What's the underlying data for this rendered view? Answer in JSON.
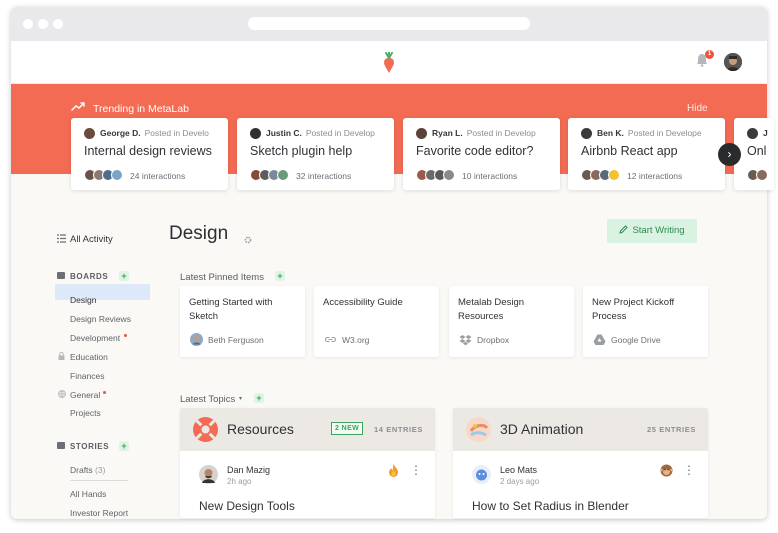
{
  "header": {
    "notification_count": "1"
  },
  "trending": {
    "title": "Trending in MetaLab",
    "hide_label": "Hide",
    "cards": [
      {
        "author": "George D.",
        "posted": "Posted in Develo",
        "title": "Internal design reviews",
        "interactions": "24 interactions"
      },
      {
        "author": "Justin C.",
        "posted": "Posted in Develop",
        "title": "Sketch plugin help",
        "interactions": "32 interactions"
      },
      {
        "author": "Ryan L.",
        "posted": "Posted in Develop",
        "title": "Favorite code editor?",
        "interactions": "10 interactions"
      },
      {
        "author": "Ben K.",
        "posted": "Posted in Develope",
        "title": "Airbnb React app",
        "interactions": "12 interactions"
      },
      {
        "author": "J",
        "posted": "",
        "title": "Onl",
        "interactions": ""
      }
    ],
    "next_glyph": "›"
  },
  "sidebar": {
    "all_activity": "All Activity",
    "boards_heading": "BOARDS",
    "boards": [
      "Design",
      "Design Reviews",
      "Development",
      "Education",
      "Finances",
      "General",
      "Projects"
    ],
    "stories_heading": "STORIES",
    "drafts": "Drafts",
    "drafts_count": "(3)",
    "stories": [
      "All Hands",
      "Investor Report"
    ],
    "plus": "+"
  },
  "main": {
    "title": "Design",
    "start_writing": "Start Writing",
    "pinned_heading": "Latest Pinned Items",
    "pinned": [
      {
        "title": "Getting Started with Sketch",
        "source": "Beth Ferguson"
      },
      {
        "title": "Accessibility Guide",
        "source": "W3.org"
      },
      {
        "title": "Metalab Design Resources",
        "source": "Dropbox"
      },
      {
        "title": "New Project Kickoff Process",
        "source": "Google Drive"
      }
    ],
    "topics_heading": "Latest Topics",
    "topics_caret": "▾",
    "topics": [
      {
        "name": "Resources",
        "badge": "2 NEW",
        "entries": "14 ENTRIES",
        "author": "Dan Mazig",
        "ago": "2h ago",
        "post_title": "New Design Tools"
      },
      {
        "name": "3D Animation",
        "badge": "",
        "entries": "25 ENTRIES",
        "author": "Leo Mats",
        "ago": "2 days ago",
        "post_title": "How to Set Radius in Blender"
      }
    ],
    "kebab": "⋮"
  },
  "colors": {
    "accent": "#f36b53",
    "green": "#3aa65b",
    "selected": "#dde9f9"
  }
}
